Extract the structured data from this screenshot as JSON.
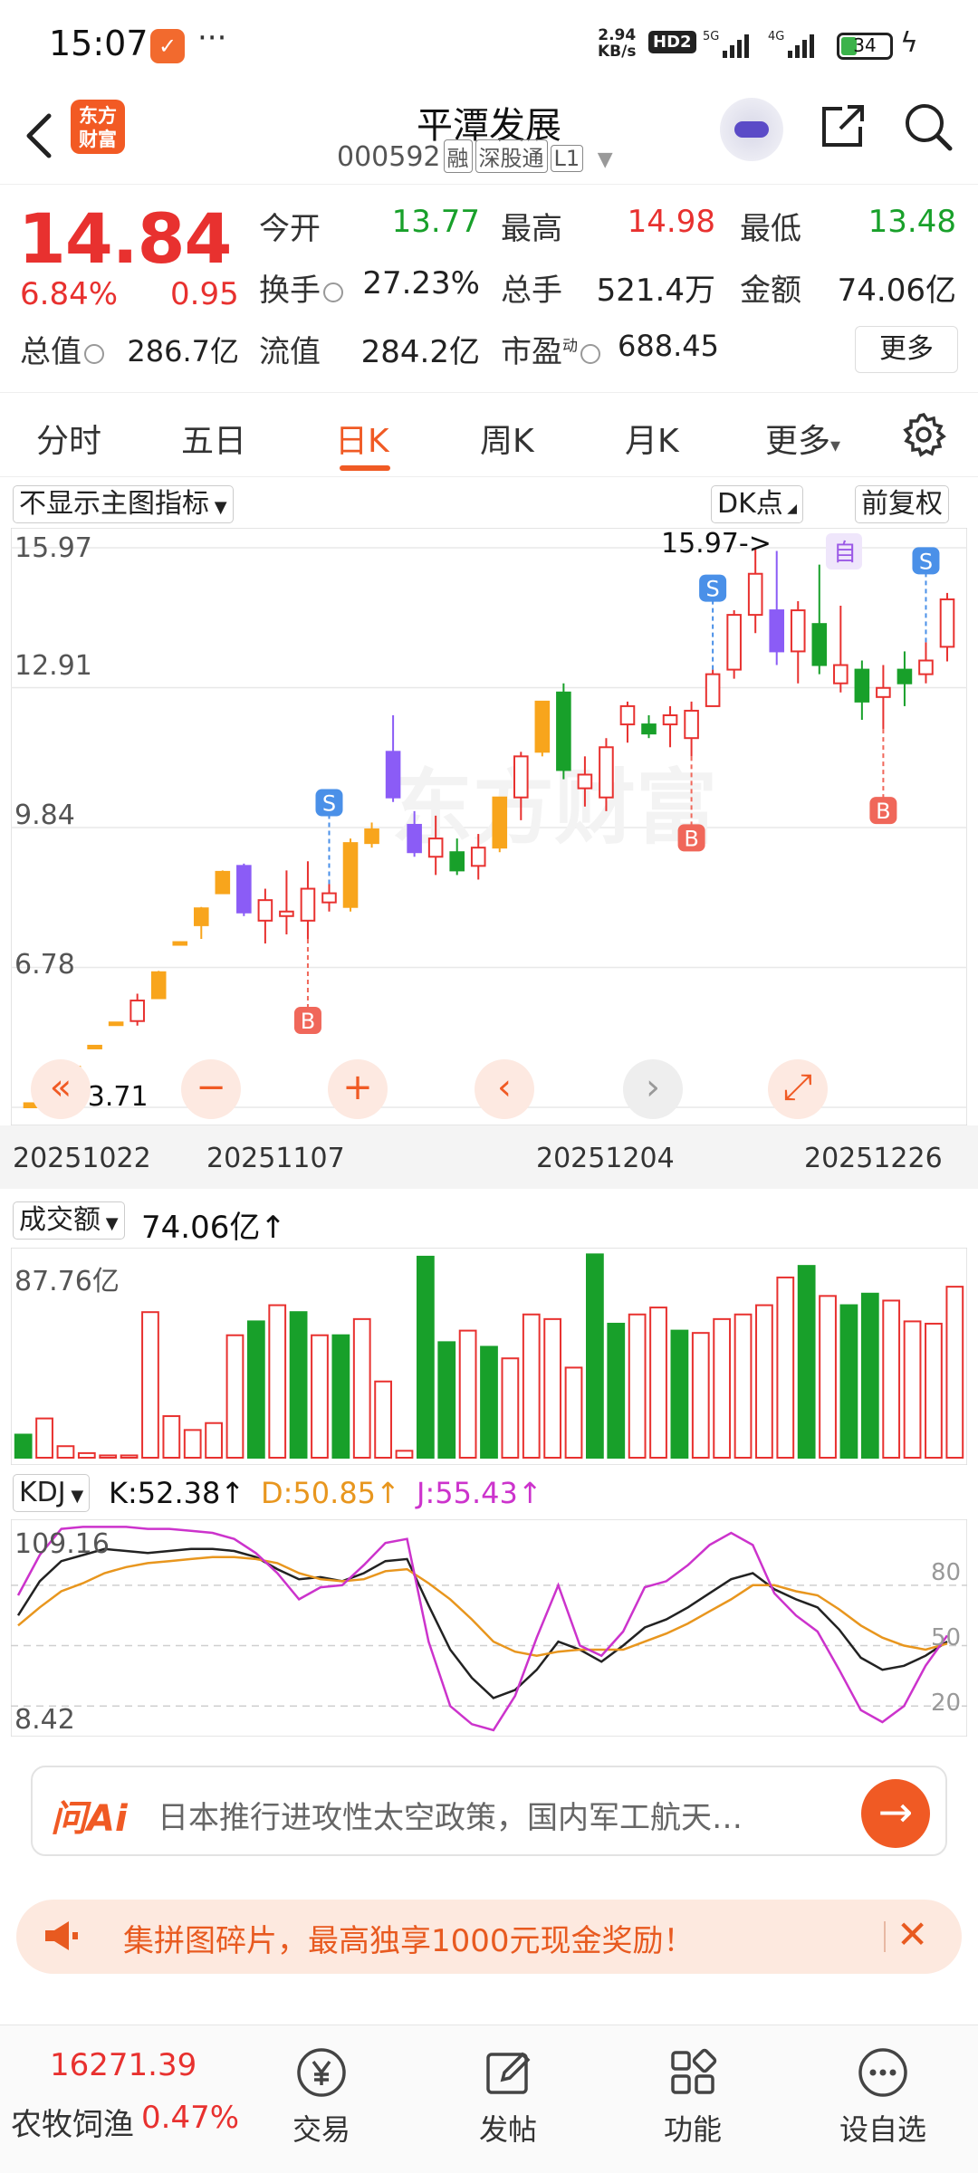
{
  "status": {
    "time": "15:07",
    "dots": "···",
    "rate": [
      "2.94",
      "KB/s"
    ],
    "hd": "HD2",
    "net1": "5G",
    "net2": "4G",
    "battery": "34"
  },
  "header": {
    "logo": [
      "东方",
      "财富"
    ],
    "name": "平潭发展",
    "code": "000592",
    "tags": [
      "融",
      "深股通",
      "L1"
    ]
  },
  "quote": {
    "price": "14.84",
    "pct": "6.84%",
    "change": "0.95",
    "open_label": "今开",
    "open": "13.77",
    "high_label": "最高",
    "high": "14.98",
    "low_label": "最低",
    "low": "13.48",
    "turnover_label": "换手",
    "turnover": "27.23%",
    "volume_label": "总手",
    "volume": "521.4万",
    "amount_label": "金额",
    "amount": "74.06亿",
    "mcap_label": "总值",
    "mcap": "286.7亿",
    "float_label": "流值",
    "float": "284.2亿",
    "pe_label": "市盈",
    "pe_sup": "动",
    "pe": "688.45",
    "more": "更多"
  },
  "tabs": [
    "分时",
    "五日",
    "日K",
    "周K",
    "月K",
    "更多"
  ],
  "tab_more_arrow": "▾",
  "active_tab": 2,
  "chart": {
    "main_indicator": "不显示主图指标",
    "dk_button": "DK点",
    "adjust_button": "前复权",
    "y_labels": [
      "15.97",
      "12.91",
      "9.84",
      "6.78",
      "3.71"
    ],
    "max_note": "15.97->",
    "min_note": "<--3.71",
    "self_marker": "自",
    "dates": [
      "20251022",
      "20251107",
      "20251204",
      "20251226"
    ],
    "watermark": "东方财富",
    "zoom_buttons": [
      "«",
      "−",
      "+",
      "‹",
      "›",
      "⤢"
    ],
    "volume_indicator": "成交额",
    "volume_value": "74.06亿↑",
    "volume_max_label": "87.76亿",
    "kdj_indicator": "KDJ",
    "kdj_k": "K:52.38↑",
    "kdj_d": "D:50.85↑",
    "kdj_j": "J:55.43↑",
    "kdj_max": "109.16",
    "kdj_min": "8.42",
    "kdj_levels": [
      "80",
      "50",
      "20"
    ],
    "colors": {
      "up": "#e8312f",
      "down": "#18a02a",
      "limit": "#f8a51c",
      "special": "#8b5cf6",
      "k": "#222222",
      "d": "#e8961e",
      "j": "#cc33cc"
    }
  },
  "chart_data": {
    "type": "candlestick",
    "ylim": [
      3.71,
      15.97
    ],
    "dates": [
      "20251022",
      "20251107",
      "20251204",
      "20251226"
    ],
    "candles": [
      {
        "o": 3.71,
        "h": 3.8,
        "l": 3.71,
        "c": 3.8,
        "t": "L"
      },
      {
        "o": 3.95,
        "h": 4.18,
        "l": 3.95,
        "c": 4.18,
        "t": "L"
      },
      {
        "o": 4.5,
        "h": 4.6,
        "l": 4.5,
        "c": 4.6,
        "t": "L"
      },
      {
        "o": 5.0,
        "h": 5.06,
        "l": 5.0,
        "c": 5.06,
        "t": "L"
      },
      {
        "o": 5.55,
        "h": 5.57,
        "l": 5.55,
        "c": 5.57,
        "t": "L"
      },
      {
        "o": 5.6,
        "h": 6.2,
        "l": 5.5,
        "c": 6.05,
        "t": "U"
      },
      {
        "o": 6.1,
        "h": 6.7,
        "l": 6.1,
        "c": 6.67,
        "t": "L"
      },
      {
        "o": 7.3,
        "h": 7.35,
        "l": 7.3,
        "c": 7.33,
        "t": "L"
      },
      {
        "o": 7.7,
        "h": 8.1,
        "l": 7.4,
        "c": 8.07,
        "t": "L"
      },
      {
        "o": 8.4,
        "h": 8.9,
        "l": 8.4,
        "c": 8.87,
        "t": "L"
      },
      {
        "o": 9.0,
        "h": 9.05,
        "l": 7.9,
        "c": 7.98,
        "t": "S"
      },
      {
        "o": 7.8,
        "h": 8.5,
        "l": 7.3,
        "c": 8.25,
        "t": "U"
      },
      {
        "o": 7.9,
        "h": 8.9,
        "l": 7.5,
        "c": 8.0,
        "t": "U"
      },
      {
        "o": 7.8,
        "h": 9.1,
        "l": 7.4,
        "c": 8.5,
        "t": "U"
      },
      {
        "o": 8.2,
        "h": 8.6,
        "l": 8.0,
        "c": 8.4,
        "t": "U"
      },
      {
        "o": 8.1,
        "h": 9.6,
        "l": 8.0,
        "c": 9.5,
        "t": "L"
      },
      {
        "o": 9.5,
        "h": 9.95,
        "l": 9.4,
        "c": 9.8,
        "t": "L"
      },
      {
        "o": 11.5,
        "h": 12.3,
        "l": 10.4,
        "c": 10.5,
        "t": "S"
      },
      {
        "o": 9.9,
        "h": 10.2,
        "l": 9.2,
        "c": 9.3,
        "t": "S"
      },
      {
        "o": 9.2,
        "h": 10.1,
        "l": 8.8,
        "c": 9.6,
        "t": "U"
      },
      {
        "o": 9.3,
        "h": 9.6,
        "l": 8.8,
        "c": 8.9,
        "t": "D"
      },
      {
        "o": 9.0,
        "h": 9.7,
        "l": 8.7,
        "c": 9.4,
        "t": "U"
      },
      {
        "o": 9.4,
        "h": 10.4,
        "l": 9.3,
        "c": 10.5,
        "t": "L"
      },
      {
        "o": 10.5,
        "h": 11.5,
        "l": 10.0,
        "c": 11.4,
        "t": "U"
      },
      {
        "o": 11.5,
        "h": 12.6,
        "l": 11.4,
        "c": 12.6,
        "t": "L"
      },
      {
        "o": 12.8,
        "h": 13.0,
        "l": 10.9,
        "c": 11.1,
        "t": "D"
      },
      {
        "o": 10.7,
        "h": 11.4,
        "l": 10.3,
        "c": 11.0,
        "t": "U"
      },
      {
        "o": 10.5,
        "h": 11.8,
        "l": 10.2,
        "c": 11.6,
        "t": "U"
      },
      {
        "o": 12.1,
        "h": 12.6,
        "l": 11.7,
        "c": 12.5,
        "t": "U"
      },
      {
        "o": 12.1,
        "h": 12.3,
        "l": 11.8,
        "c": 11.9,
        "t": "D"
      },
      {
        "o": 12.1,
        "h": 12.5,
        "l": 11.6,
        "c": 12.3,
        "t": "U"
      },
      {
        "o": 11.8,
        "h": 12.6,
        "l": 11.4,
        "c": 12.4,
        "t": "U"
      },
      {
        "o": 12.5,
        "h": 13.3,
        "l": 12.5,
        "c": 13.2,
        "t": "U"
      },
      {
        "o": 13.3,
        "h": 14.6,
        "l": 13.1,
        "c": 14.5,
        "t": "U"
      },
      {
        "o": 14.5,
        "h": 15.97,
        "l": 14.1,
        "c": 15.4,
        "t": "U"
      },
      {
        "o": 14.6,
        "h": 15.9,
        "l": 13.4,
        "c": 13.7,
        "t": "S"
      },
      {
        "o": 13.7,
        "h": 14.8,
        "l": 13.0,
        "c": 14.6,
        "t": "U"
      },
      {
        "o": 14.3,
        "h": 15.6,
        "l": 13.2,
        "c": 13.4,
        "t": "D"
      },
      {
        "o": 13.4,
        "h": 14.7,
        "l": 12.8,
        "c": 13.0,
        "t": "U"
      },
      {
        "o": 13.3,
        "h": 13.5,
        "l": 12.2,
        "c": 12.6,
        "t": "D"
      },
      {
        "o": 12.7,
        "h": 13.4,
        "l": 12.0,
        "c": 12.9,
        "t": "U"
      },
      {
        "o": 13.3,
        "h": 13.7,
        "l": 12.5,
        "c": 13.0,
        "t": "D"
      },
      {
        "o": 13.2,
        "h": 13.9,
        "l": 13.0,
        "c": 13.5,
        "t": "U"
      },
      {
        "o": 13.8,
        "h": 14.98,
        "l": 13.48,
        "c": 14.84,
        "t": "U"
      }
    ],
    "signals": [
      {
        "i": 13,
        "kind": "B"
      },
      {
        "i": 14,
        "kind": "S"
      },
      {
        "i": 31,
        "kind": "B"
      },
      {
        "i": 32,
        "kind": "S"
      },
      {
        "i": 40,
        "kind": "B"
      },
      {
        "i": 42,
        "kind": "S"
      }
    ],
    "volume": {
      "ymax": 87.76,
      "bars": [
        {
          "v": 10,
          "t": "D"
        },
        {
          "v": 17,
          "t": "U"
        },
        {
          "v": 5,
          "t": "U"
        },
        {
          "v": 2,
          "t": "U"
        },
        {
          "v": 1,
          "t": "U"
        },
        {
          "v": 1,
          "t": "U"
        },
        {
          "v": 63,
          "t": "U"
        },
        {
          "v": 18,
          "t": "U"
        },
        {
          "v": 12,
          "t": "U"
        },
        {
          "v": 15,
          "t": "U"
        },
        {
          "v": 53,
          "t": "U"
        },
        {
          "v": 59,
          "t": "D"
        },
        {
          "v": 66,
          "t": "U"
        },
        {
          "v": 63,
          "t": "D"
        },
        {
          "v": 53,
          "t": "U"
        },
        {
          "v": 53,
          "t": "D"
        },
        {
          "v": 60,
          "t": "U"
        },
        {
          "v": 33,
          "t": "U"
        },
        {
          "v": 3,
          "t": "U"
        },
        {
          "v": 87,
          "t": "D"
        },
        {
          "v": 50,
          "t": "D"
        },
        {
          "v": 55,
          "t": "U"
        },
        {
          "v": 48,
          "t": "D"
        },
        {
          "v": 43,
          "t": "U"
        },
        {
          "v": 62,
          "t": "U"
        },
        {
          "v": 60,
          "t": "U"
        },
        {
          "v": 39,
          "t": "U"
        },
        {
          "v": 88,
          "t": "D"
        },
        {
          "v": 58,
          "t": "D"
        },
        {
          "v": 62,
          "t": "U"
        },
        {
          "v": 65,
          "t": "U"
        },
        {
          "v": 55,
          "t": "D"
        },
        {
          "v": 54,
          "t": "U"
        },
        {
          "v": 60,
          "t": "U"
        },
        {
          "v": 62,
          "t": "U"
        },
        {
          "v": 66,
          "t": "U"
        },
        {
          "v": 78,
          "t": "U"
        },
        {
          "v": 83,
          "t": "D"
        },
        {
          "v": 70,
          "t": "U"
        },
        {
          "v": 66,
          "t": "D"
        },
        {
          "v": 71,
          "t": "D"
        },
        {
          "v": 68,
          "t": "U"
        },
        {
          "v": 59,
          "t": "U"
        },
        {
          "v": 58,
          "t": "U"
        },
        {
          "v": 74,
          "t": "U"
        }
      ]
    },
    "kdj": {
      "ylim": [
        8.42,
        109.16
      ],
      "K": [
        65,
        82,
        92,
        95,
        98,
        97,
        96,
        97,
        98,
        98,
        97,
        94,
        88,
        83,
        84,
        82,
        86,
        92,
        93,
        70,
        48,
        34,
        24,
        28,
        38,
        52,
        48,
        42,
        50,
        59,
        63,
        69,
        76,
        83,
        86,
        78,
        73,
        69,
        58,
        44,
        38,
        40,
        45,
        52
      ],
      "D": [
        60,
        69,
        77,
        81,
        86,
        89,
        91,
        92,
        93,
        94,
        94,
        93,
        91,
        86,
        83,
        82,
        83,
        87,
        88,
        81,
        73,
        63,
        52,
        47,
        45,
        47,
        48,
        48,
        48,
        52,
        56,
        61,
        67,
        73,
        80,
        80,
        77,
        75,
        68,
        60,
        54,
        50,
        48,
        51
      ],
      "J": [
        75,
        95,
        108,
        109,
        109,
        109,
        108,
        108,
        107,
        106,
        103,
        96,
        86,
        73,
        79,
        80,
        90,
        101,
        103,
        52,
        20,
        11,
        8,
        25,
        54,
        80,
        50,
        45,
        57,
        79,
        82,
        90,
        100,
        106,
        100,
        76,
        65,
        57,
        38,
        18,
        12,
        20,
        40,
        55
      ]
    }
  },
  "ai": {
    "logo": "问Ai",
    "text": "日本推行进攻性太空政策，国内军工航天…",
    "go": "→"
  },
  "promo": {
    "text": "集拼图碎片，最高独享1000元现金奖励！",
    "close": "✕"
  },
  "bottom": {
    "index_value": "16271.39",
    "index_name": "农牧饲渔",
    "index_pct": "0.47%",
    "nav": [
      "交易",
      "发帖",
      "功能",
      "设自选"
    ]
  }
}
